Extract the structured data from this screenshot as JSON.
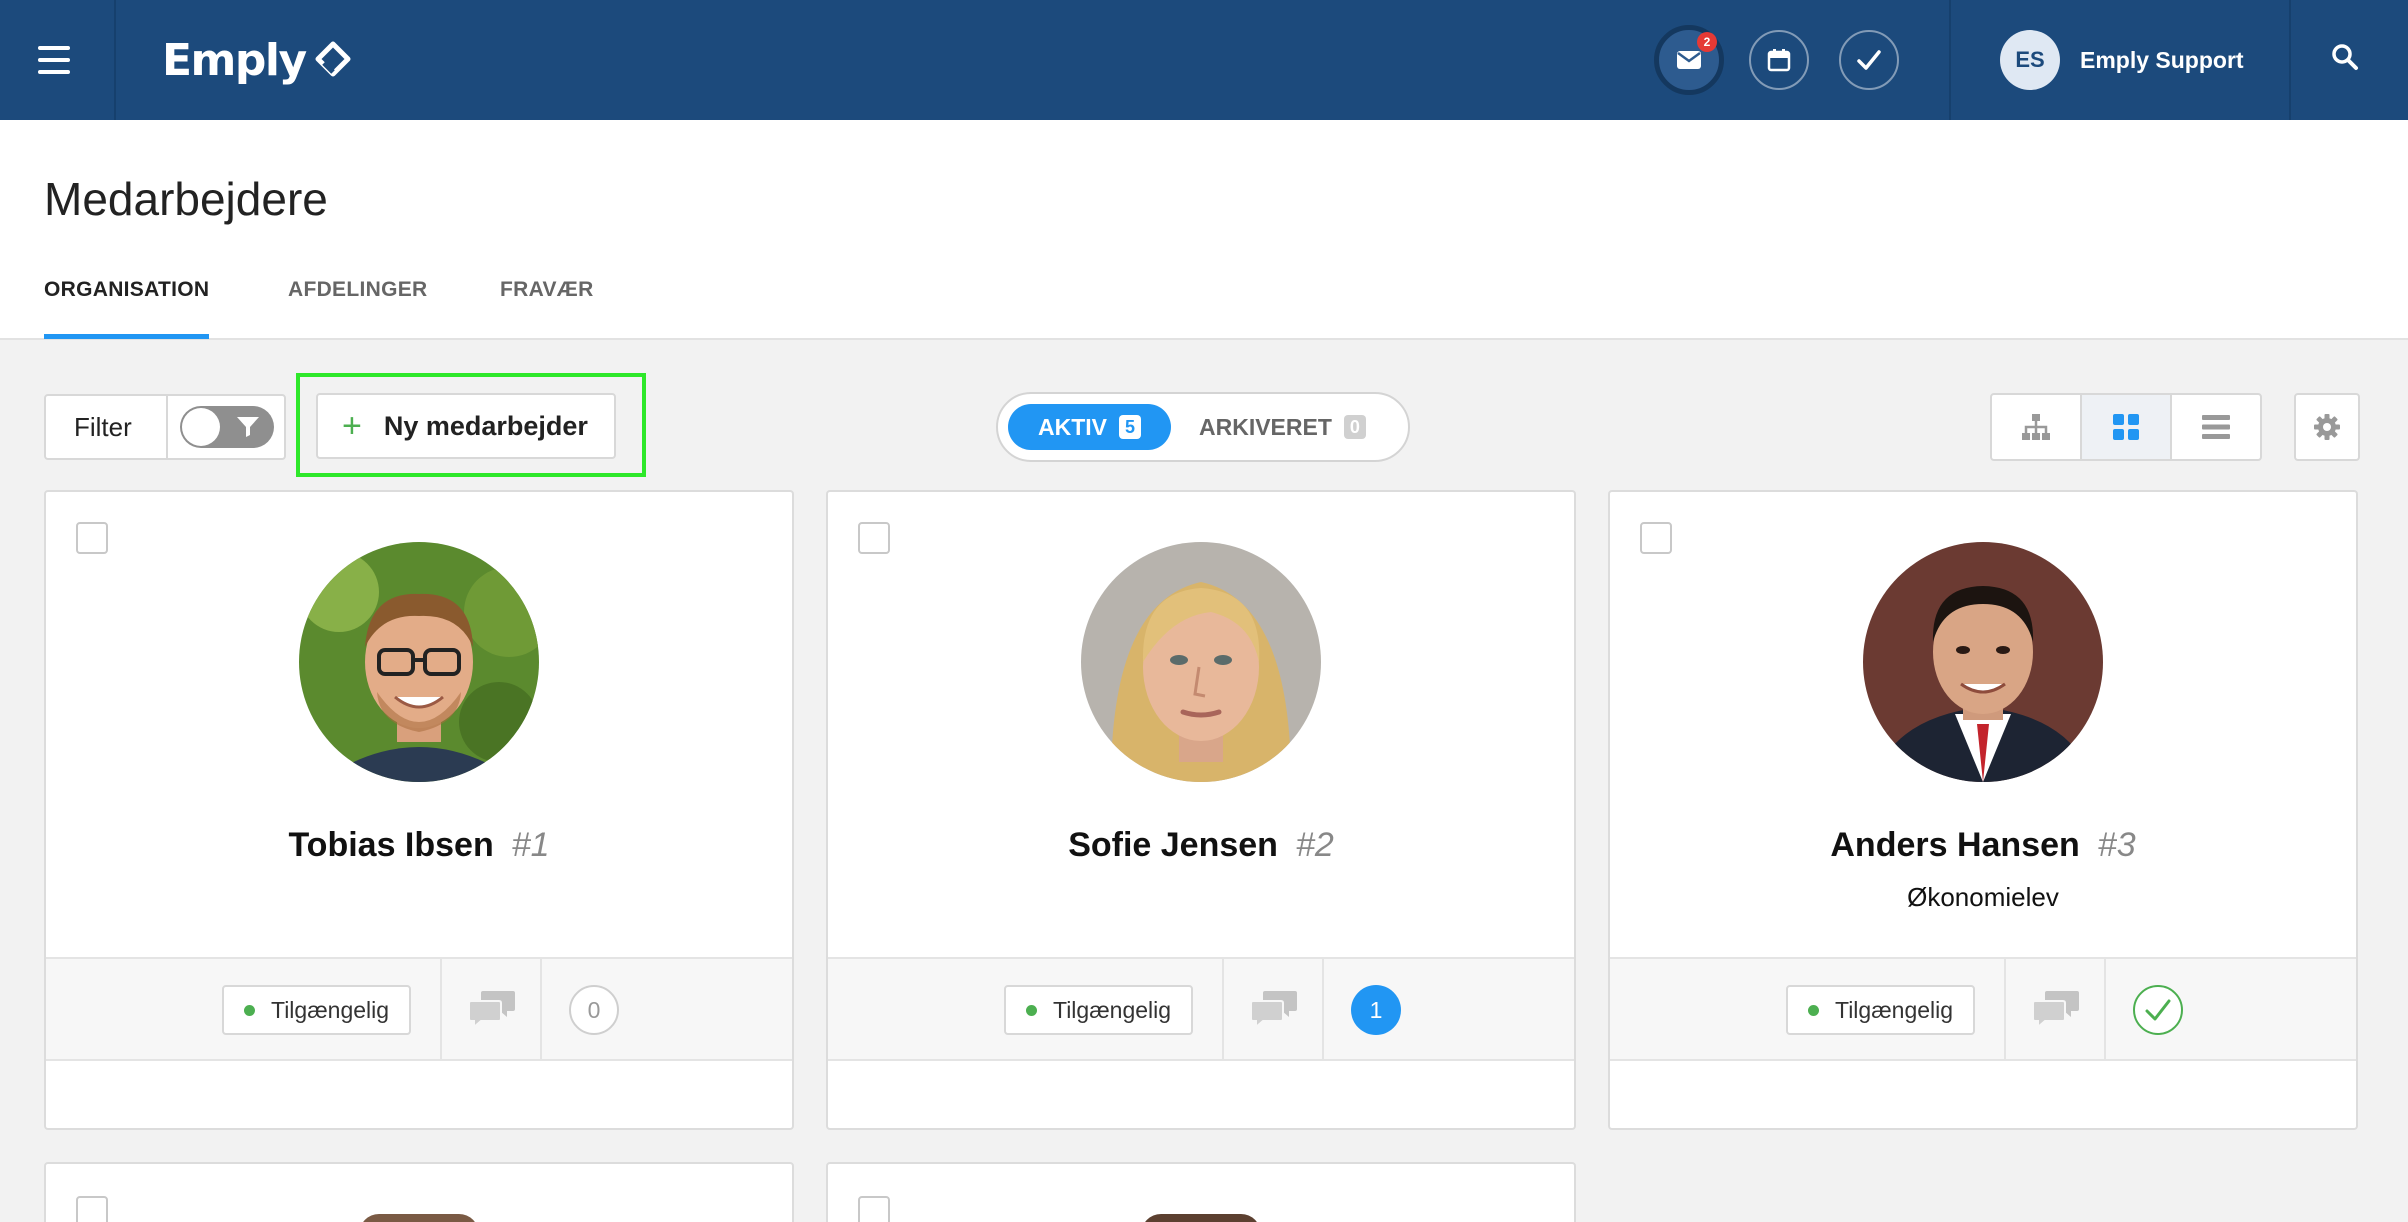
{
  "header": {
    "brand": "Emply",
    "mail_badge": "2",
    "user_initials": "ES",
    "user_name": "Emply Support"
  },
  "page": {
    "title": "Medarbejdere",
    "tabs": [
      {
        "label": "ORGANISATION",
        "active": true
      },
      {
        "label": "AFDELINGER",
        "active": false
      },
      {
        "label": "FRAVÆR",
        "active": false
      }
    ]
  },
  "toolbar": {
    "filter_label": "Filter",
    "new_employee_label": "Ny medarbejder",
    "segments": [
      {
        "label": "AKTIV",
        "count": "5",
        "active": true
      },
      {
        "label": "ARKIVERET",
        "count": "0",
        "active": false
      }
    ],
    "active_view": "grid"
  },
  "colors": {
    "header_bg": "#1c4a7c",
    "accent": "#2196f3",
    "available_green": "#4caf50",
    "highlight_green": "#2ee82a"
  },
  "employees": [
    {
      "name": "Tobias Ibsen",
      "number": "#1",
      "role": "",
      "status": "Tilgængelig",
      "tasks": "0",
      "tasks_state": "zero"
    },
    {
      "name": "Sofie Jensen",
      "number": "#2",
      "role": "",
      "status": "Tilgængelig",
      "tasks": "1",
      "tasks_state": "one"
    },
    {
      "name": "Anders Hansen",
      "number": "#3",
      "role": "Økonomielev",
      "status": "Tilgængelig",
      "tasks": "",
      "tasks_state": "done"
    }
  ]
}
